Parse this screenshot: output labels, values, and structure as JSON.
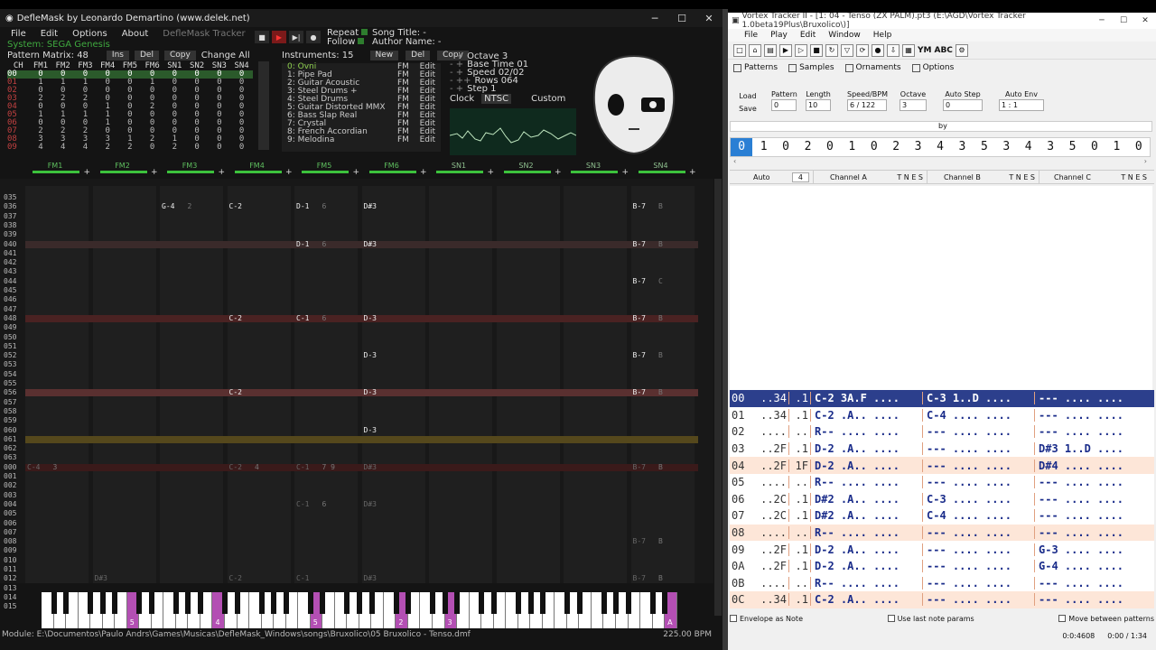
{
  "deflemask": {
    "title": "DefleMask by Leonardo Demartino (www.delek.net)",
    "menu": [
      "File",
      "Edit",
      "Options",
      "About"
    ],
    "menu_ghost": "DefleMask Tracker",
    "system": "System: SEGA Genesis",
    "repeat_label": "Repeat",
    "follow_label": "Follow",
    "song_title": "Song Title: -",
    "author_name": "Author Name: -",
    "pattern_matrix_label": "Pattern Matrix: 48",
    "pm_buttons": [
      "Ins",
      "Del",
      "Copy"
    ],
    "change_all": "Change All",
    "pm_columns": [
      "CH",
      "FM1",
      "FM2",
      "FM3",
      "FM4",
      "FM5",
      "FM6",
      "SN1",
      "SN2",
      "SN3",
      "SN4"
    ],
    "pm_rows": [
      [
        "00",
        "0",
        "0",
        "0",
        "0",
        "0",
        "0",
        "0",
        "0",
        "0",
        "0"
      ],
      [
        "01",
        "1",
        "1",
        "1",
        "0",
        "0",
        "1",
        "0",
        "0",
        "0",
        "0"
      ],
      [
        "02",
        "0",
        "0",
        "0",
        "0",
        "0",
        "0",
        "0",
        "0",
        "0",
        "0"
      ],
      [
        "03",
        "2",
        "2",
        "2",
        "0",
        "0",
        "0",
        "0",
        "0",
        "0",
        "0"
      ],
      [
        "04",
        "0",
        "0",
        "0",
        "1",
        "0",
        "2",
        "0",
        "0",
        "0",
        "0"
      ],
      [
        "05",
        "1",
        "1",
        "1",
        "1",
        "0",
        "0",
        "0",
        "0",
        "0",
        "0"
      ],
      [
        "06",
        "0",
        "0",
        "0",
        "1",
        "0",
        "0",
        "0",
        "0",
        "0",
        "0"
      ],
      [
        "07",
        "2",
        "2",
        "2",
        "0",
        "0",
        "0",
        "0",
        "0",
        "0",
        "0"
      ],
      [
        "08",
        "3",
        "3",
        "3",
        "3",
        "1",
        "2",
        "1",
        "0",
        "0",
        "0"
      ],
      [
        "09",
        "4",
        "4",
        "4",
        "2",
        "2",
        "0",
        "2",
        "0",
        "0",
        "0"
      ]
    ],
    "instruments_label": "Instruments: 15",
    "inst_buttons": [
      "New",
      "Del",
      "Copy"
    ],
    "instruments": [
      "0: Ovni",
      "1: Pipe Pad",
      "2: Guitar Acoustic",
      "3: Steel Drums +",
      "4: Steel Drums",
      "5: Guitar Distorted MMX",
      "6: Bass Slap Real",
      "7: Crystal",
      "8: French Accordian",
      "9: Melodina"
    ],
    "inst_type": "FM",
    "inst_edit": "Edit",
    "octave": "Octave 3",
    "base_time": "Base Time 01",
    "speed": "Speed 02/02",
    "rows": "Rows 064",
    "step": "Step 1",
    "clock_label": "Clock",
    "clock_value": "NTSC",
    "custom_label": "Custom",
    "channels": [
      "FM1",
      "FM2",
      "FM3",
      "FM4",
      "FM5",
      "FM6",
      "SN1",
      "SN2",
      "SN3",
      "SN4"
    ],
    "row_numbers": [
      "035",
      "036",
      "037",
      "038",
      "039",
      "040",
      "041",
      "042",
      "043",
      "044",
      "045",
      "046",
      "047",
      "048",
      "049",
      "050",
      "051",
      "052",
      "053",
      "054",
      "055",
      "056",
      "057",
      "058",
      "059",
      "060",
      "061",
      "062",
      "063",
      "000",
      "001",
      "002",
      "003",
      "004",
      "005",
      "006",
      "007",
      "008",
      "009",
      "010",
      "011",
      "012",
      "013",
      "014",
      "015"
    ],
    "notes": [
      {
        "label": "G-4",
        "extra": "2"
      },
      {
        "label": "C-2",
        "extra": ""
      },
      {
        "label": "D-1",
        "extra": "6"
      },
      {
        "label": "D#3",
        "extra": ""
      },
      {
        "label": "B-7",
        "extra": "B"
      },
      {
        "label": "D-1",
        "extra": "6"
      },
      {
        "label": "D#3",
        "extra": ""
      },
      {
        "label": "B-7",
        "extra": "B"
      },
      {
        "label": "B-7",
        "extra": "C"
      },
      {
        "label": "C-2",
        "extra": ""
      },
      {
        "label": "C-1",
        "extra": "6"
      },
      {
        "label": "D-3",
        "extra": ""
      },
      {
        "label": "B-7",
        "extra": "B"
      },
      {
        "label": "D-3",
        "extra": ""
      },
      {
        "label": "B-7",
        "extra": "B"
      },
      {
        "label": "C-2",
        "extra": ""
      },
      {
        "label": "D-3",
        "extra": ""
      },
      {
        "label": "B-7",
        "extra": "B"
      },
      {
        "label": "D-3",
        "extra": ""
      },
      {
        "label": "C-4",
        "extra": "3"
      },
      {
        "label": "C-2",
        "extra": "4"
      },
      {
        "label": "C-1",
        "extra": "7 9"
      },
      {
        "label": "D#3",
        "extra": ""
      },
      {
        "label": "B-7",
        "extra": "B"
      },
      {
        "label": "C-1",
        "extra": "6"
      },
      {
        "label": "D#3",
        "extra": ""
      },
      {
        "label": "B-7",
        "extra": "B"
      },
      {
        "label": "D#3",
        "extra": ""
      },
      {
        "label": "C-2",
        "extra": ""
      },
      {
        "label": "C-1",
        "extra": ""
      },
      {
        "label": "D#3",
        "extra": ""
      },
      {
        "label": "B-7",
        "extra": "B"
      }
    ],
    "piano_marks": [
      "5",
      "4",
      "5",
      "2",
      "3",
      "A"
    ],
    "status_module": "Module: E:\\Documentos\\Paulo Andrs\\Games\\Musicas\\DefleMask_Windows\\songs\\Bruxolico\\05 Bruxolico - Tenso.dmf",
    "status_bpm": "225.00 BPM"
  },
  "vortex": {
    "title": "Vortex Tracker II - [1: 04 - Tenso (ZX PALM).pt3 (E:\\AGD\\Vortex Tracker 1.0beta19Plus\\Bruxolico\\)]",
    "menu": [
      "File",
      "Play",
      "Edit",
      "Window",
      "Help"
    ],
    "tool_labels": [
      "YM",
      "ABC"
    ],
    "tabs": [
      "Patterns",
      "Samples",
      "Ornaments",
      "Options"
    ],
    "load": "Load",
    "save": "Save",
    "pattern_label": "Pattern",
    "pattern_value": "0",
    "length_label": "Length",
    "length_value": "10",
    "speed_label": "Speed/BPM",
    "speed_value": "6 / 122",
    "octave_label": "Octave",
    "octave_value": "3",
    "autostep_label": "Auto Step",
    "autostep_value": "0",
    "autoenv_label": "Auto Env",
    "autoenv_value": "1 : 1",
    "by_label": "by",
    "order": [
      "0",
      "1",
      "0",
      "2",
      "0",
      "1",
      "0",
      "2",
      "3",
      "4",
      "3",
      "5",
      "3",
      "4",
      "3",
      "5",
      "0",
      "1",
      "0"
    ],
    "auto_label": "Auto",
    "auto_value": "4",
    "channel_a": "Channel A",
    "channel_b": "Channel B",
    "channel_c": "Channel C",
    "tnes": "T  N  E  S",
    "rows": [
      {
        "ln": "00",
        "sa": "..34",
        "sb": ".1",
        "a": "C-2 3A.F ....",
        "b": "C-3 1..D ....",
        "c": "--- .... ...."
      },
      {
        "ln": "01",
        "sa": "..34",
        "sb": ".1",
        "a": "C-2 .A.. ....",
        "b": "C-4 .... ....",
        "c": "--- .... ...."
      },
      {
        "ln": "02",
        "sa": "....",
        "sb": "..",
        "a": "R-- .... ....",
        "b": "--- .... ....",
        "c": "--- .... ...."
      },
      {
        "ln": "03",
        "sa": "..2F",
        "sb": ".1",
        "a": "D-2 .A.. ....",
        "b": "--- .... ....",
        "c": "D#3 1..D ...."
      },
      {
        "ln": "04",
        "sa": "..2F",
        "sb": "1F",
        "a": "D-2 .A.. ....",
        "b": "--- .... ....",
        "c": "D#4 .... ...."
      },
      {
        "ln": "05",
        "sa": "....",
        "sb": "..",
        "a": "R-- .... ....",
        "b": "--- .... ....",
        "c": "--- .... ...."
      },
      {
        "ln": "06",
        "sa": "..2C",
        "sb": ".1",
        "a": "D#2 .A.. ....",
        "b": "C-3 .... ....",
        "c": "--- .... ...."
      },
      {
        "ln": "07",
        "sa": "..2C",
        "sb": ".1",
        "a": "D#2 .A.. ....",
        "b": "C-4 .... ....",
        "c": "--- .... ...."
      },
      {
        "ln": "08",
        "sa": "....",
        "sb": "..",
        "a": "R-- .... ....",
        "b": "--- .... ....",
        "c": "--- .... ...."
      },
      {
        "ln": "09",
        "sa": "..2F",
        "sb": ".1",
        "a": "D-2 .A.. ....",
        "b": "--- .... ....",
        "c": "G-3 .... ...."
      },
      {
        "ln": "0A",
        "sa": "..2F",
        "sb": ".1",
        "a": "D-2 .A.. ....",
        "b": "--- .... ....",
        "c": "G-4 .... ...."
      },
      {
        "ln": "0B",
        "sa": "....",
        "sb": "..",
        "a": "R-- .... ....",
        "b": "--- .... ....",
        "c": "--- .... ...."
      },
      {
        "ln": "0C",
        "sa": "..34",
        "sb": ".1",
        "a": "C-2 .A.. ....",
        "b": "--- .... ....",
        "c": "--- .... ...."
      }
    ],
    "envelope_as_note": "Envelope as Note",
    "use_last_note": "Use last note params",
    "move_between": "Move between patterns",
    "status_time": "0:0:4608",
    "status_pos": "0:00 / 1:34"
  }
}
